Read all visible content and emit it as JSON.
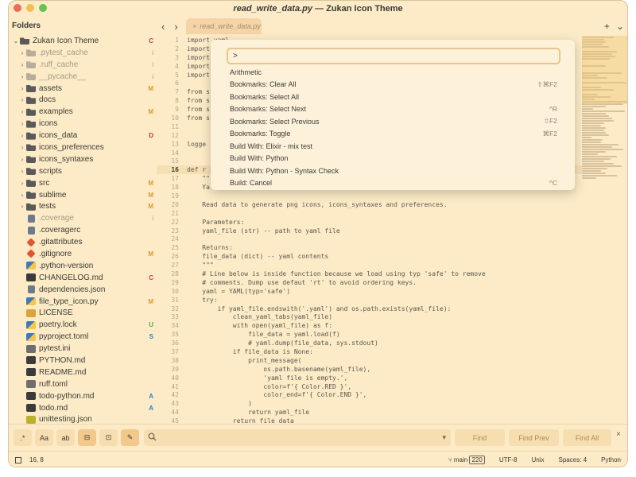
{
  "window": {
    "title_file": "read_write_data.py",
    "title_rest": " — Zukan Icon Theme"
  },
  "sidebar": {
    "heading": "Folders",
    "items": [
      {
        "label": "Zukan Icon Theme",
        "type": "folder",
        "expanded": true,
        "badge": "C",
        "dim": false,
        "depth": 0
      },
      {
        "label": ".pytest_cache",
        "type": "folder",
        "badge": "i",
        "dim": true,
        "depth": 1
      },
      {
        "label": ".ruff_cache",
        "type": "folder",
        "badge": "i",
        "dim": true,
        "depth": 1
      },
      {
        "label": "__pycache__",
        "type": "folder",
        "badge": "i",
        "dim": true,
        "depth": 1
      },
      {
        "label": "assets",
        "type": "folder",
        "badge": "M",
        "dim": false,
        "depth": 1
      },
      {
        "label": "docs",
        "type": "folder",
        "badge": "",
        "dim": false,
        "depth": 1
      },
      {
        "label": "examples",
        "type": "folder",
        "badge": "M",
        "dim": false,
        "depth": 1
      },
      {
        "label": "icons",
        "type": "folder",
        "badge": "",
        "dim": false,
        "depth": 1
      },
      {
        "label": "icons_data",
        "type": "folder",
        "badge": "D",
        "dim": false,
        "depth": 1
      },
      {
        "label": "icons_preferences",
        "type": "folder",
        "badge": "",
        "dim": false,
        "depth": 1
      },
      {
        "label": "icons_syntaxes",
        "type": "folder",
        "badge": "",
        "dim": false,
        "depth": 1
      },
      {
        "label": "scripts",
        "type": "folder",
        "badge": "",
        "dim": false,
        "depth": 1
      },
      {
        "label": "src",
        "type": "folder",
        "badge": "M",
        "dim": false,
        "depth": 1
      },
      {
        "label": "sublime",
        "type": "folder",
        "badge": "M",
        "dim": false,
        "depth": 1
      },
      {
        "label": "tests",
        "type": "folder",
        "badge": "M",
        "dim": false,
        "depth": 1
      },
      {
        "label": ".coverage",
        "type": "file",
        "badge": "i",
        "dim": true,
        "depth": 1
      },
      {
        "label": ".coveragerc",
        "type": "gear",
        "badge": "",
        "dim": false,
        "depth": 1
      },
      {
        "label": ".gitattributes",
        "type": "git",
        "badge": "",
        "dim": false,
        "depth": 1
      },
      {
        "label": ".gitignore",
        "type": "git",
        "badge": "M",
        "dim": false,
        "depth": 1
      },
      {
        "label": ".python-version",
        "type": "py",
        "badge": "",
        "dim": false,
        "depth": 1
      },
      {
        "label": "CHANGELOG.md",
        "type": "md",
        "badge": "C",
        "dim": false,
        "depth": 1
      },
      {
        "label": "dependencies.json",
        "type": "file",
        "badge": "",
        "dim": false,
        "depth": 1
      },
      {
        "label": "file_type_icon.py",
        "type": "py",
        "badge": "M",
        "dim": false,
        "depth": 1
      },
      {
        "label": "LICENSE",
        "type": "lic",
        "badge": "",
        "dim": false,
        "depth": 1
      },
      {
        "label": "poetry.lock",
        "type": "py",
        "badge": "U",
        "dim": false,
        "depth": 1
      },
      {
        "label": "pyproject.toml",
        "type": "py",
        "badge": "S",
        "dim": false,
        "depth": 1
      },
      {
        "label": "pytest.ini",
        "type": "toml",
        "badge": "",
        "dim": false,
        "depth": 1
      },
      {
        "label": "PYTHON.md",
        "type": "md",
        "badge": "",
        "dim": false,
        "depth": 1
      },
      {
        "label": "README.md",
        "type": "md",
        "badge": "",
        "dim": false,
        "depth": 1
      },
      {
        "label": "ruff.toml",
        "type": "toml",
        "badge": "",
        "dim": false,
        "depth": 1
      },
      {
        "label": "todo-python.md",
        "type": "md",
        "badge": "A",
        "dim": false,
        "depth": 1
      },
      {
        "label": "todo.md",
        "type": "md",
        "badge": "A",
        "dim": false,
        "depth": 1
      },
      {
        "label": "unittesting.json",
        "type": "json",
        "badge": "",
        "dim": false,
        "depth": 1
      }
    ]
  },
  "tabbar": {
    "back": "‹",
    "forward": "›",
    "tab_label": "read_write_data.py",
    "tab_close": "×",
    "new_tab": "+",
    "menu": "⌄"
  },
  "editor": {
    "current_line": 16,
    "lines": [
      {
        "n": "1",
        "t": "import yaml"
      },
      {
        "n": "2",
        "t": "import "
      },
      {
        "n": "3",
        "t": "import "
      },
      {
        "n": "4",
        "t": "import "
      },
      {
        "n": "5",
        "t": "import "
      },
      {
        "n": "6",
        "t": ""
      },
      {
        "n": "7",
        "t": "from s"
      },
      {
        "n": "8",
        "t": "from s"
      },
      {
        "n": "9",
        "t": "from s"
      },
      {
        "n": "10",
        "t": "from s"
      },
      {
        "n": "11",
        "t": ""
      },
      {
        "n": "12",
        "t": ""
      },
      {
        "n": "13",
        "t": "logge"
      },
      {
        "n": "14",
        "t": ""
      },
      {
        "n": "15",
        "t": ""
      },
      {
        "n": "16",
        "t": "def r"
      },
      {
        "n": "17",
        "t": "    \"\"\""
      },
      {
        "n": "18",
        "t": "    Ya"
      },
      {
        "n": "19",
        "t": ""
      },
      {
        "n": "20",
        "t": "    Read data to generate png icons, icons_syntaxes and preferences."
      },
      {
        "n": "21",
        "t": ""
      },
      {
        "n": "22",
        "t": "    Parameters:"
      },
      {
        "n": "23",
        "t": "    yaml_file (str) -- path to yaml file"
      },
      {
        "n": "24",
        "t": ""
      },
      {
        "n": "25",
        "t": "    Returns:"
      },
      {
        "n": "26",
        "t": "    file_data (dict) -- yaml contents"
      },
      {
        "n": "27",
        "t": "    \"\"\""
      },
      {
        "n": "28",
        "t": "    # Line below is inside function because we load using typ 'safe' to remove"
      },
      {
        "n": "29",
        "t": "    # comments. Dump use defaut 'rt' to avoid ordering keys."
      },
      {
        "n": "30",
        "t": "    yaml = YAML(typ='safe')"
      },
      {
        "n": "31",
        "t": "    try:"
      },
      {
        "n": "32",
        "t": "        if yaml_file.endswith('.yaml') and os.path.exists(yaml_file):"
      },
      {
        "n": "33",
        "t": "            clean_yaml_tabs(yaml_file)"
      },
      {
        "n": "34",
        "t": "            with open(yaml_file) as f:"
      },
      {
        "n": "35",
        "t": "                file_data = yaml.load(f)"
      },
      {
        "n": "36",
        "t": "                # yaml.dump(file_data, sys.stdout)"
      },
      {
        "n": "37",
        "t": "            if file_data is None:"
      },
      {
        "n": "38",
        "t": "                print_message("
      },
      {
        "n": "39",
        "t": "                    os.path.basename(yaml_file),"
      },
      {
        "n": "40",
        "t": "                    'yaml file is empty.',"
      },
      {
        "n": "41",
        "t": "                    color=f'{ Color.RED }',"
      },
      {
        "n": "42",
        "t": "                    color_end=f'{ Color.END }',"
      },
      {
        "n": "43",
        "t": "                )"
      },
      {
        "n": "44",
        "t": "                return yaml_file"
      },
      {
        "n": "45",
        "t": "            return file_data"
      }
    ]
  },
  "palette": {
    "input_value": ">",
    "items": [
      {
        "label": "Arithmetic",
        "shortcut": ""
      },
      {
        "label": "Bookmarks: Clear All",
        "shortcut": "⇧⌘F2"
      },
      {
        "label": "Bookmarks: Select All",
        "shortcut": ""
      },
      {
        "label": "Bookmarks: Select Next",
        "shortcut": "^R"
      },
      {
        "label": "Bookmarks: Select Previous",
        "shortcut": "⇧F2"
      },
      {
        "label": "Bookmarks: Toggle",
        "shortcut": "⌘F2"
      },
      {
        "label": "Build With: Elixir - mix test",
        "shortcut": ""
      },
      {
        "label": "Build With: Python",
        "shortcut": ""
      },
      {
        "label": "Build With: Python - Syntax Check",
        "shortcut": ""
      },
      {
        "label": "Build: Cancel",
        "shortcut": "^C"
      }
    ]
  },
  "findbar": {
    "toggles": [
      {
        "icon": "regex-icon",
        "glyph": ".*",
        "active": false
      },
      {
        "icon": "case-icon",
        "glyph": "Aa",
        "active": false
      },
      {
        "icon": "whole-word-icon",
        "glyph": "ab",
        "active": false
      },
      {
        "icon": "wrap-icon",
        "glyph": "⊟",
        "active": true
      },
      {
        "icon": "in-selection-icon",
        "glyph": "⊡",
        "active": false
      },
      {
        "icon": "highlight-icon",
        "glyph": "✎",
        "active": true
      }
    ],
    "search_value": "",
    "find_label": "Find",
    "find_prev_label": "Find Prev",
    "find_all_label": "Find All",
    "close": "×"
  },
  "status": {
    "position": "16, 8",
    "branch": "main",
    "branch_count": "220",
    "encoding": "UTF-8",
    "line_endings": "Unix",
    "indentation": "Spaces: 4",
    "syntax": "Python"
  },
  "colors": {
    "background": "#fcebc6",
    "accent": "#f2c98b",
    "badge_modified": "#d99a2b",
    "badge_conflict": "#cc3d3d"
  }
}
